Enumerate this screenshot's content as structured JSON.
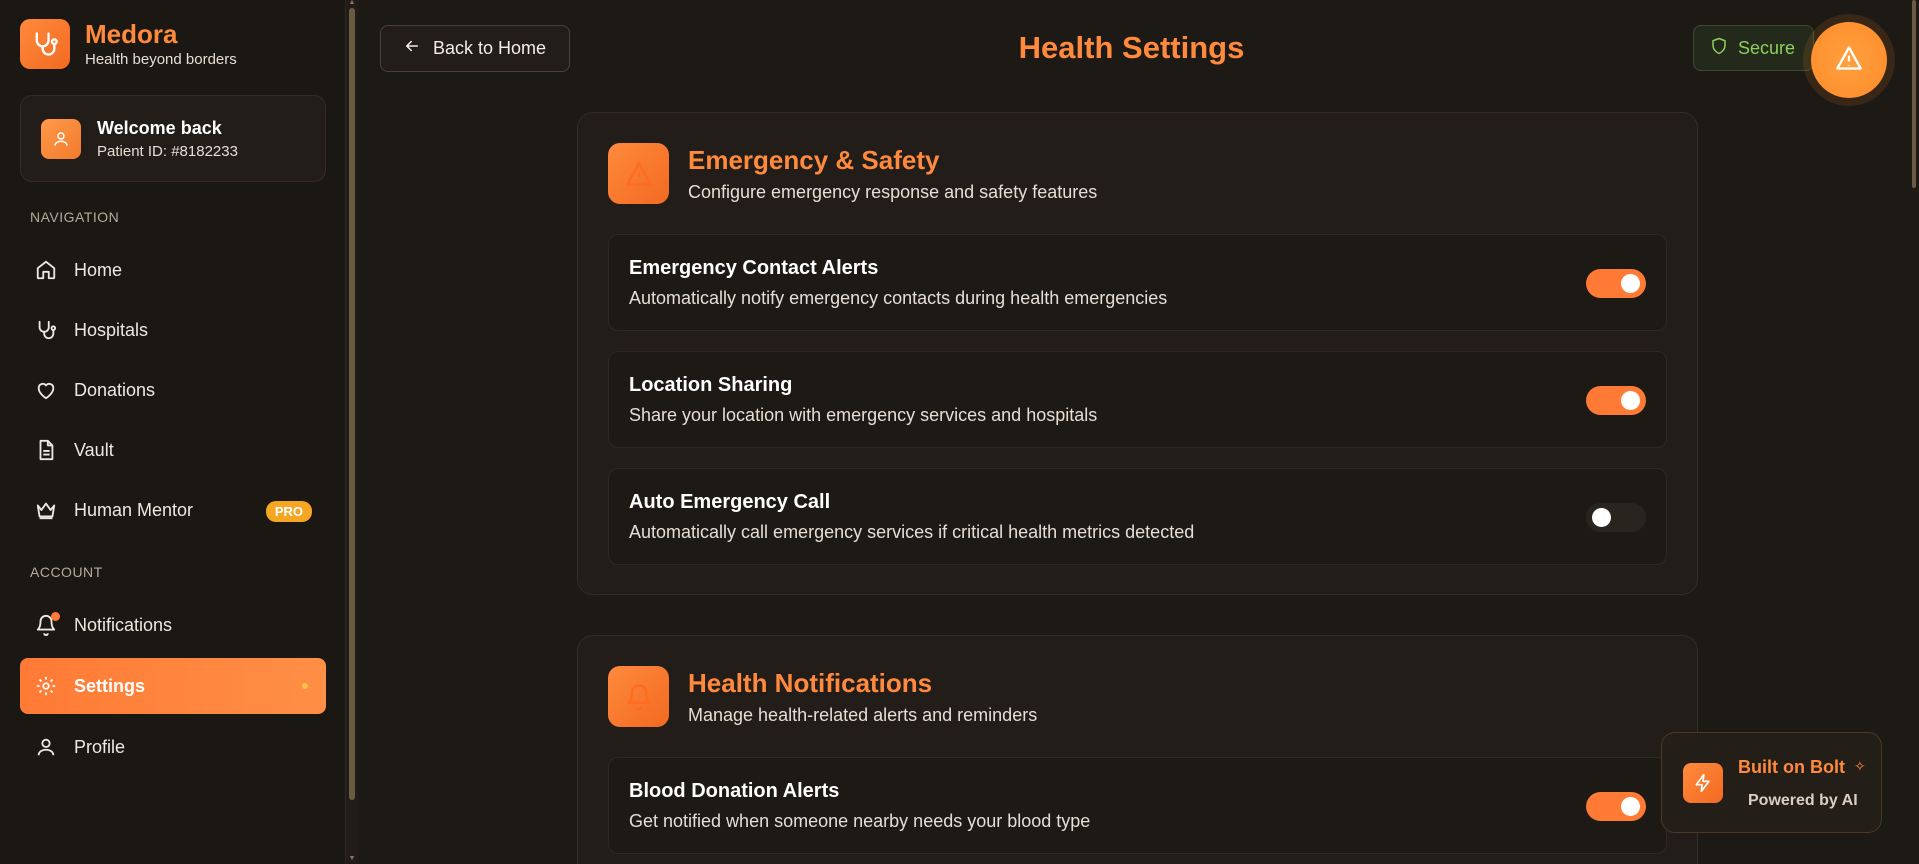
{
  "brand": {
    "name": "Medora",
    "tagline": "Health beyond borders"
  },
  "welcome": {
    "title": "Welcome back",
    "patient_id": "Patient ID: #8182233"
  },
  "sidebar": {
    "nav_label": "NAVIGATION",
    "nav_items": [
      {
        "label": "Home",
        "icon": "home-icon"
      },
      {
        "label": "Hospitals",
        "icon": "stethoscope-icon"
      },
      {
        "label": "Donations",
        "icon": "heart-icon"
      },
      {
        "label": "Vault",
        "icon": "document-icon"
      },
      {
        "label": "Human Mentor",
        "icon": "crown-icon",
        "badge": "PRO"
      }
    ],
    "account_label": "ACCOUNT",
    "account_items": [
      {
        "label": "Notifications",
        "icon": "bell-icon"
      },
      {
        "label": "Settings",
        "icon": "gear-icon",
        "active": true
      },
      {
        "label": "Profile",
        "icon": "user-icon"
      }
    ]
  },
  "header": {
    "back_label": "Back to Home",
    "title": "Health Settings",
    "secure_label": "Secure"
  },
  "sections": [
    {
      "title": "Emergency & Safety",
      "subtitle": "Configure emergency response and safety features",
      "icon": "warning-icon",
      "settings": [
        {
          "title": "Emergency Contact Alerts",
          "desc": "Automatically notify emergency contacts during health emergencies",
          "enabled": true
        },
        {
          "title": "Location Sharing",
          "desc": "Share your location with emergency services and hospitals",
          "enabled": true
        },
        {
          "title": "Auto Emergency Call",
          "desc": "Automatically call emergency services if critical health metrics detected",
          "enabled": false
        }
      ]
    },
    {
      "title": "Health Notifications",
      "subtitle": "Manage health-related alerts and reminders",
      "icon": "bell-icon",
      "settings": [
        {
          "title": "Blood Donation Alerts",
          "desc": "Get notified when someone nearby needs your blood type",
          "enabled": true
        }
      ]
    }
  ],
  "bolt": {
    "title": "Built on Bolt",
    "subtitle": "Powered by AI"
  },
  "colors": {
    "accent": "#ff8a3d",
    "background": "#1d1915",
    "secure": "#8fcf5a"
  }
}
